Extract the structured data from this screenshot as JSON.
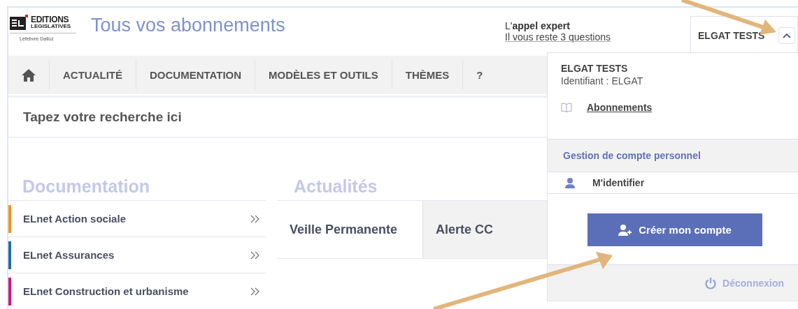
{
  "header": {
    "logo": {
      "line1": "EDITIONS",
      "line2": "LEGISLATIVES",
      "tagline": "Lefebvre Dalloz"
    },
    "title": "Tous vos abonnements",
    "expert": {
      "label": "L'**appel expert**",
      "link": "Il vous reste 3 questions"
    },
    "account": {
      "name": "ELGAT TESTS",
      "expanded": true
    }
  },
  "nav": [
    {
      "kind": "home"
    },
    {
      "kind": "text",
      "label": "ACTUALITÉ"
    },
    {
      "kind": "text",
      "label": "DOCUMENTATION"
    },
    {
      "kind": "text",
      "label": "MODÈLES ET OUTILS"
    },
    {
      "kind": "text",
      "label": "THÈMES"
    },
    {
      "kind": "text",
      "label": "?"
    }
  ],
  "search": {
    "placeholder": "Tapez votre recherche ici"
  },
  "documentation": {
    "title": "Documentation",
    "items": [
      {
        "label": "ELnet Action sociale",
        "color": "#f39322"
      },
      {
        "label": "ELnet Assurances",
        "color": "#1f6ea6"
      },
      {
        "label": "ELnet Construction et urbanisme",
        "color": "#d4147f"
      }
    ]
  },
  "news": {
    "title": "Actualités",
    "tabs": [
      {
        "label": "Veille Permanente",
        "selected": true
      },
      {
        "label": "Alerte CC",
        "selected": false
      }
    ]
  },
  "menu": {
    "user_name": "ELGAT TESTS",
    "identifier": "Identifiant :  ELGAT",
    "links": [
      {
        "label": "Abonnements"
      }
    ],
    "section": "Gestion de compte personnel",
    "login": "M'identifier",
    "create_button": "Créer mon compte",
    "logout": "Déconnexion"
  }
}
